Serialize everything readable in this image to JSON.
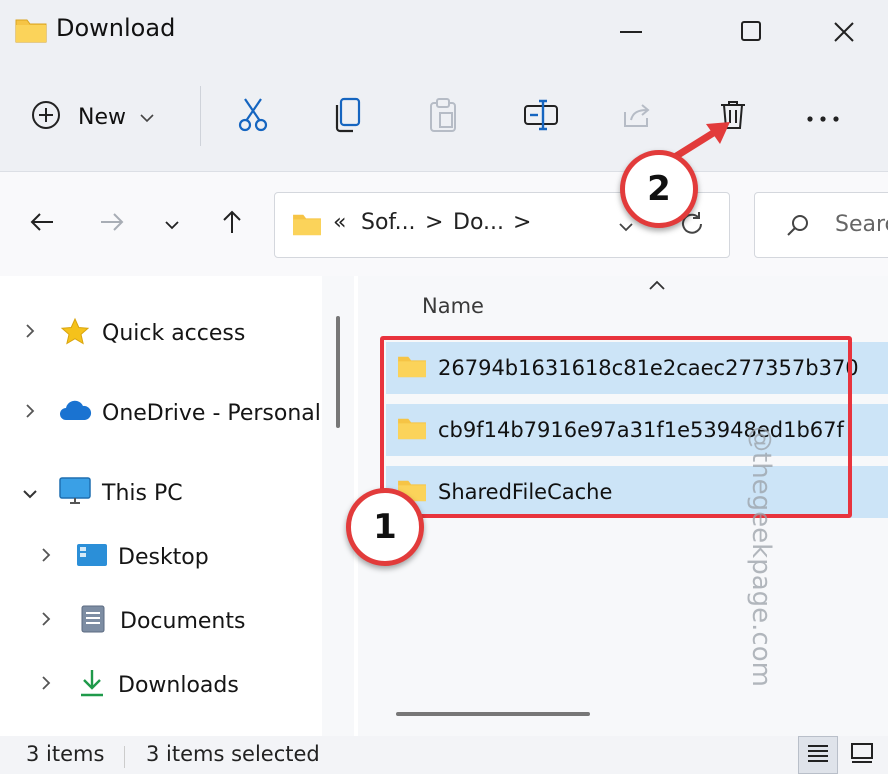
{
  "window": {
    "title": "Download",
    "controls": {
      "minimize": "minimize",
      "maximize": "maximize",
      "close": "close"
    }
  },
  "toolbar": {
    "new_label": "New",
    "icons": [
      "plus-circle-icon",
      "chevron-down-icon",
      "cut-icon",
      "copy-icon",
      "paste-icon",
      "rename-icon",
      "share-icon",
      "delete-icon",
      "more-icon"
    ],
    "more_label": "···"
  },
  "navigation": {
    "address": {
      "overflow": "«",
      "segments": [
        "Sof...",
        "Do..."
      ],
      "separator": ">"
    },
    "search_placeholder": "Search"
  },
  "sidebar": {
    "items": [
      {
        "label": "Quick access",
        "icon": "star-icon",
        "expanded": false
      },
      {
        "label": "OneDrive - Personal",
        "icon": "cloud-icon",
        "expanded": false
      },
      {
        "label": "This PC",
        "icon": "monitor-icon",
        "expanded": true
      },
      {
        "label": "Desktop",
        "icon": "desktop-icon",
        "expanded": false
      },
      {
        "label": "Documents",
        "icon": "document-icon",
        "expanded": false
      },
      {
        "label": "Downloads",
        "icon": "download-icon",
        "expanded": false
      }
    ]
  },
  "file_list": {
    "column_header": "Name",
    "files": [
      {
        "name": "26794b1631618c81e2caec277357b370",
        "selected": true
      },
      {
        "name": "cb9f14b7916e97a31f1e53948ed1b67f",
        "selected": true
      },
      {
        "name": "SharedFileCache",
        "selected": true
      }
    ]
  },
  "status": {
    "item_count": "3 items",
    "selected_count": "3 items selected"
  },
  "annotations": {
    "callout_1": "1",
    "callout_2": "2",
    "watermark": "@thegeekpage.com"
  },
  "colors": {
    "folder": "#f6c445",
    "selection": "#cce4f7",
    "annotation_red": "#e8333d",
    "accent_blue": "#1565c0"
  }
}
